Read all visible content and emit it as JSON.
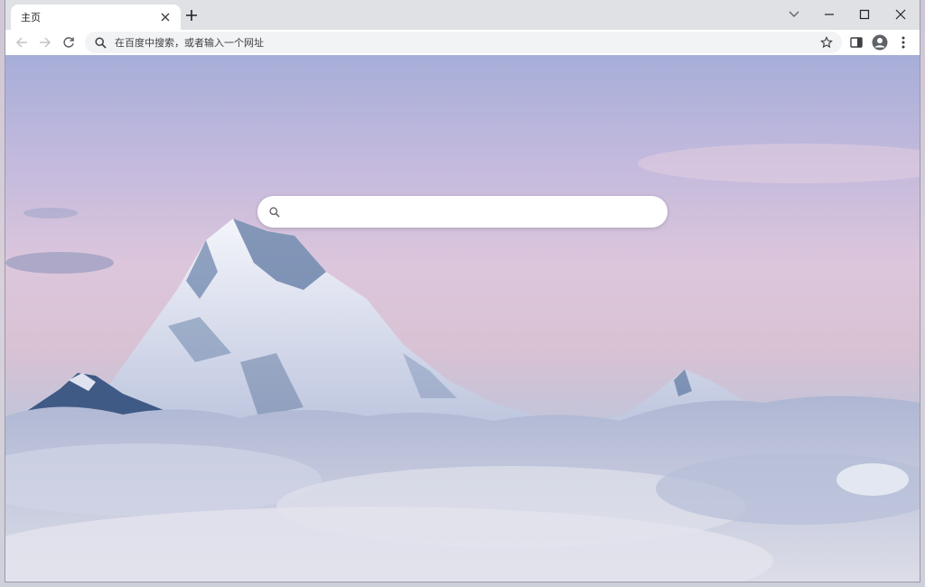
{
  "browser": {
    "tab": {
      "title": "主页",
      "close_icon": "close-icon"
    },
    "new_tab_icon": "plus-icon",
    "window_controls": [
      "tab-search-icon",
      "minimize-icon",
      "maximize-icon",
      "close-icon"
    ],
    "toolbar": {
      "back_icon": "back-arrow-icon",
      "forward_icon": "forward-arrow-icon",
      "reload_icon": "reload-icon",
      "omnibox": {
        "placeholder": "在百度中搜索，或者输入一个网址",
        "search_icon": "search-icon",
        "bookmark_icon": "star-icon"
      },
      "side_panel_icon": "side-panel-icon",
      "profile_icon": "profile-avatar-icon",
      "menu_icon": "more-vertical-icon"
    }
  },
  "page": {
    "background": "snow-capped mountain above clouds",
    "search": {
      "value": "",
      "icon": "search-icon"
    }
  },
  "colors": {
    "titlebar": "#dfe1e5",
    "omnibox_bg": "#f1f3f4",
    "icon": "#5f6368",
    "icon_disabled": "#c2c4c7"
  }
}
